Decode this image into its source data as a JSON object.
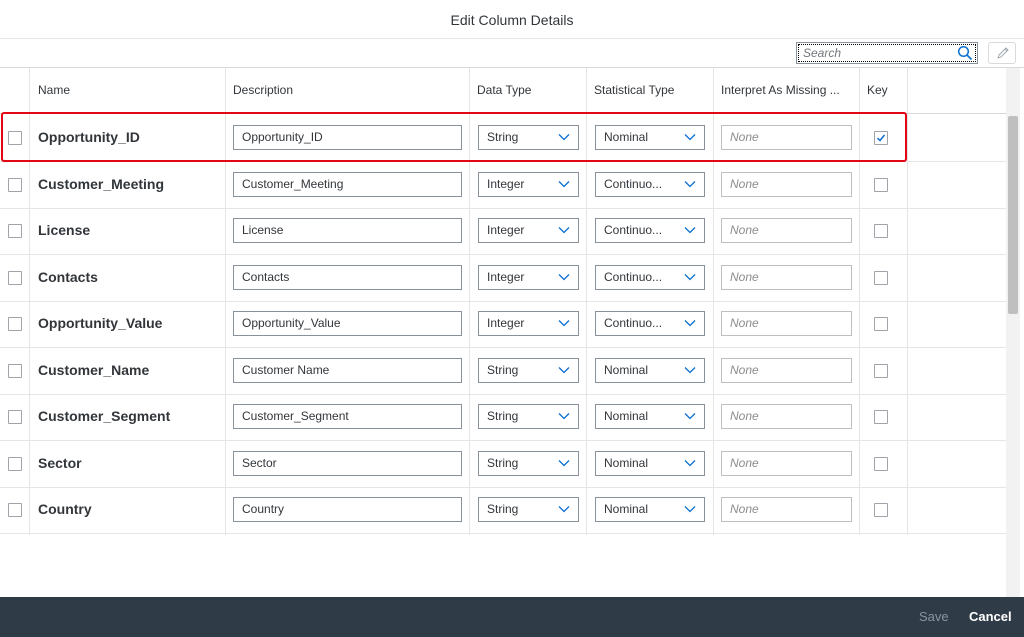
{
  "dialog": {
    "title": "Edit Column Details"
  },
  "toolbar": {
    "search_placeholder": "Search",
    "search_icon": "search-icon",
    "edit_icon": "pencil-icon"
  },
  "table": {
    "headers": {
      "name": "Name",
      "description": "Description",
      "data_type": "Data Type",
      "statistical_type": "Statistical Type",
      "missing": "Interpret As Missing ...",
      "key": "Key"
    },
    "rows": [
      {
        "name": "Opportunity_ID",
        "description": "Opportunity_ID",
        "data_type": "String",
        "statistical_type": "Nominal",
        "missing_placeholder": "None",
        "key": true
      },
      {
        "name": "Customer_Meeting",
        "description": "Customer_Meeting",
        "data_type": "Integer",
        "statistical_type": "Continuo...",
        "missing_placeholder": "None",
        "key": false
      },
      {
        "name": "License",
        "description": "License",
        "data_type": "Integer",
        "statistical_type": "Continuo...",
        "missing_placeholder": "None",
        "key": false
      },
      {
        "name": "Contacts",
        "description": "Contacts",
        "data_type": "Integer",
        "statistical_type": "Continuo...",
        "missing_placeholder": "None",
        "key": false
      },
      {
        "name": "Opportunity_Value",
        "description": "Opportunity_Value",
        "data_type": "Integer",
        "statistical_type": "Continuo...",
        "missing_placeholder": "None",
        "key": false
      },
      {
        "name": "Customer_Name",
        "description": "Customer Name",
        "data_type": "String",
        "statistical_type": "Nominal",
        "missing_placeholder": "None",
        "key": false
      },
      {
        "name": "Customer_Segment",
        "description": "Customer_Segment",
        "data_type": "String",
        "statistical_type": "Nominal",
        "missing_placeholder": "None",
        "key": false
      },
      {
        "name": "Sector",
        "description": "Sector",
        "data_type": "String",
        "statistical_type": "Nominal",
        "missing_placeholder": "None",
        "key": false
      },
      {
        "name": "Country",
        "description": "Country",
        "data_type": "String",
        "statistical_type": "Nominal",
        "missing_placeholder": "None",
        "key": false
      }
    ]
  },
  "footer": {
    "save_label": "Save",
    "cancel_label": "Cancel"
  },
  "colors": {
    "footer_bg": "#2f3c48",
    "highlight": "#e30613",
    "accent": "#0a6ed1"
  }
}
